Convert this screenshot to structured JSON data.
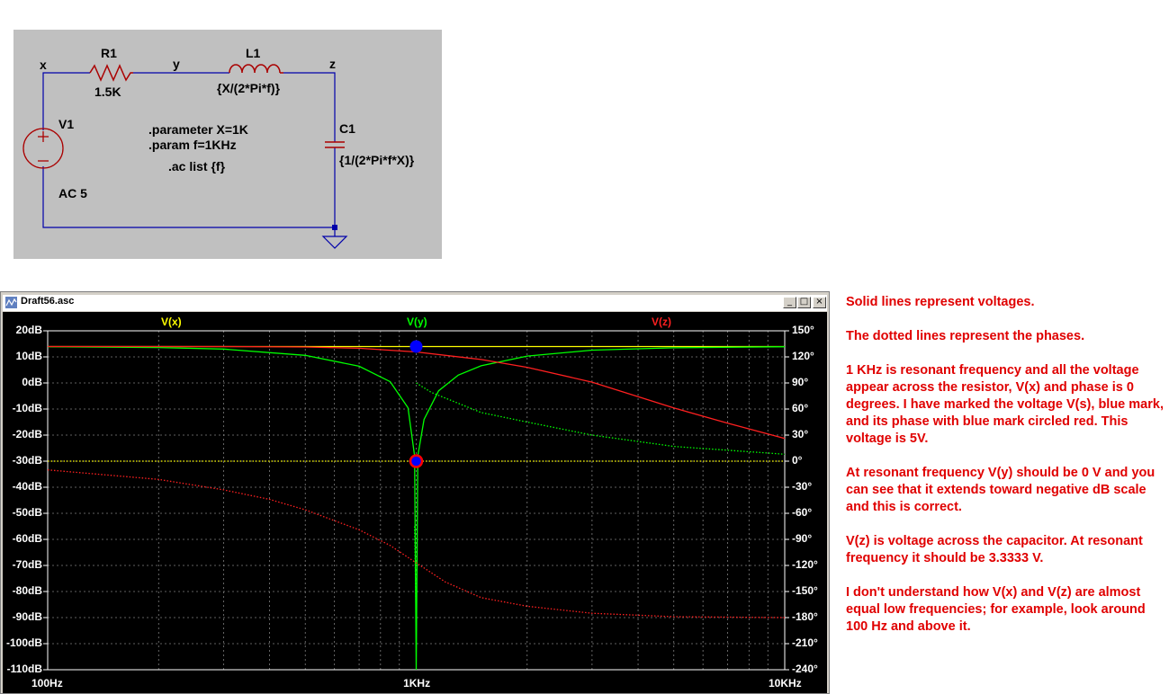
{
  "schematic": {
    "nodes": {
      "x": "x",
      "y": "y",
      "z": "z"
    },
    "r1": {
      "name": "R1",
      "value": "1.5K"
    },
    "l1": {
      "name": "L1",
      "value": "{X/(2*Pi*f)}"
    },
    "c1": {
      "name": "C1",
      "value": "{1/(2*Pi*f*X)}"
    },
    "v1": {
      "name": "V1",
      "value": "AC 5"
    },
    "directives": [
      ".parameter X=1K",
      ".param f=1KHz",
      ".ac list {f}"
    ]
  },
  "window": {
    "title": "Draft56.asc",
    "buttons": {
      "minimize": "_",
      "maximize": "□",
      "close": "×"
    }
  },
  "chart_data": {
    "type": "line",
    "traces": [
      "V(x)",
      "V(y)",
      "V(z)"
    ],
    "trace_colors": {
      "V(x)": "#ffff00",
      "V(y)": "#00ff00",
      "V(z)": "#ff2020"
    },
    "x_scale": "log",
    "x_range": [
      "100Hz",
      "10KHz"
    ],
    "x_tick_labels": [
      "100Hz",
      "1KHz",
      "10KHz"
    ],
    "y_left_range": [
      -110,
      20
    ],
    "y_left_ticks": [
      "20dB",
      "10dB",
      "0dB",
      "-10dB",
      "-20dB",
      "-30dB",
      "-40dB",
      "-50dB",
      "-60dB",
      "-70dB",
      "-80dB",
      "-90dB",
      "-100dB",
      "-110dB"
    ],
    "y_right_range": [
      -240,
      150
    ],
    "y_right_ticks": [
      "150°",
      "120°",
      "90°",
      "60°",
      "30°",
      "0°",
      "-30°",
      "-60°",
      "-90°",
      "-120°",
      "-150°",
      "-180°",
      "-210°",
      "-240°"
    ],
    "grid": true,
    "series": [
      {
        "name": "V(x)",
        "kind": "magnitude",
        "style": "solid",
        "x": [
          100,
          1000,
          10000
        ],
        "y": [
          13.98,
          13.98,
          13.98
        ]
      },
      {
        "name": "V(x)",
        "kind": "phase",
        "style": "dotted",
        "x": [
          100,
          1000,
          10000
        ],
        "y": [
          0,
          0,
          0
        ]
      },
      {
        "name": "V(y)",
        "kind": "magnitude",
        "style": "solid",
        "x": [
          100,
          200,
          300,
          500,
          700,
          850,
          950,
          990,
          1000,
          1010,
          1050,
          1150,
          1300,
          1500,
          2000,
          3000,
          5000,
          10000
        ],
        "y": [
          13.9,
          13.6,
          13.0,
          10.6,
          6.4,
          0.5,
          -9.5,
          -28,
          -110,
          -28,
          -14,
          -3.0,
          3.0,
          6.6,
          10.3,
          12.6,
          13.5,
          13.9
        ]
      },
      {
        "name": "V(y)",
        "kind": "phase",
        "style": "dotted",
        "x": [
          1000,
          1100,
          1500,
          2000,
          3000,
          5000,
          10000
        ],
        "y": [
          90,
          79,
          56,
          45,
          30,
          17,
          8
        ]
      },
      {
        "name": "V(y)",
        "kind": "phase",
        "style": "dotted",
        "x": [
          990,
          1000
        ],
        "y": [
          -75,
          -185
        ]
      },
      {
        "name": "V(z)",
        "kind": "magnitude",
        "style": "solid",
        "x": [
          100,
          300,
          500,
          700,
          1000,
          1500,
          2000,
          3000,
          5000,
          7000,
          10000
        ],
        "y": [
          13.98,
          13.98,
          13.8,
          13.3,
          11.9,
          9.0,
          6.0,
          0.3,
          -9.6,
          -15.4,
          -21.3
        ]
      },
      {
        "name": "V(z)",
        "kind": "phase",
        "style": "dotted",
        "x": [
          100,
          200,
          300,
          400,
          500,
          700,
          850,
          1000,
          1200,
          1500,
          2000,
          3000,
          5000,
          10000
        ],
        "y": [
          -10,
          -21,
          -33,
          -44,
          -56,
          -79,
          -97,
          -117,
          -139,
          -157,
          -167,
          -175,
          -179,
          -180
        ]
      }
    ],
    "markers": [
      {
        "name": "cursor-magnitude",
        "x": 1000,
        "y_db": 13.98,
        "color": "#0000ff"
      },
      {
        "name": "cursor-phase",
        "x": 1000,
        "y_deg": 0,
        "fill": "#0000ff",
        "ring": "#ff0000"
      }
    ]
  },
  "notes": [
    "Solid lines represent voltages.",
    "The dotted lines represent the phases.",
    "1 KHz is resonant frequency and all the voltage appear across the resistor, V(x) and phase is 0 degrees. I have marked the voltage V(s), blue mark, and its phase with blue mark circled red. This voltage is 5V.",
    "At resonant frequency V(y) should be 0 V and you can see that it extends toward negative dB scale and this is correct.",
    "V(z) is voltage across the capacitor. At resonant frequency it should be 3.3333 V.",
    "I don't understand how V(x) and V(z) are almost equal low frequencies; for example, look around 100 Hz and above it."
  ]
}
